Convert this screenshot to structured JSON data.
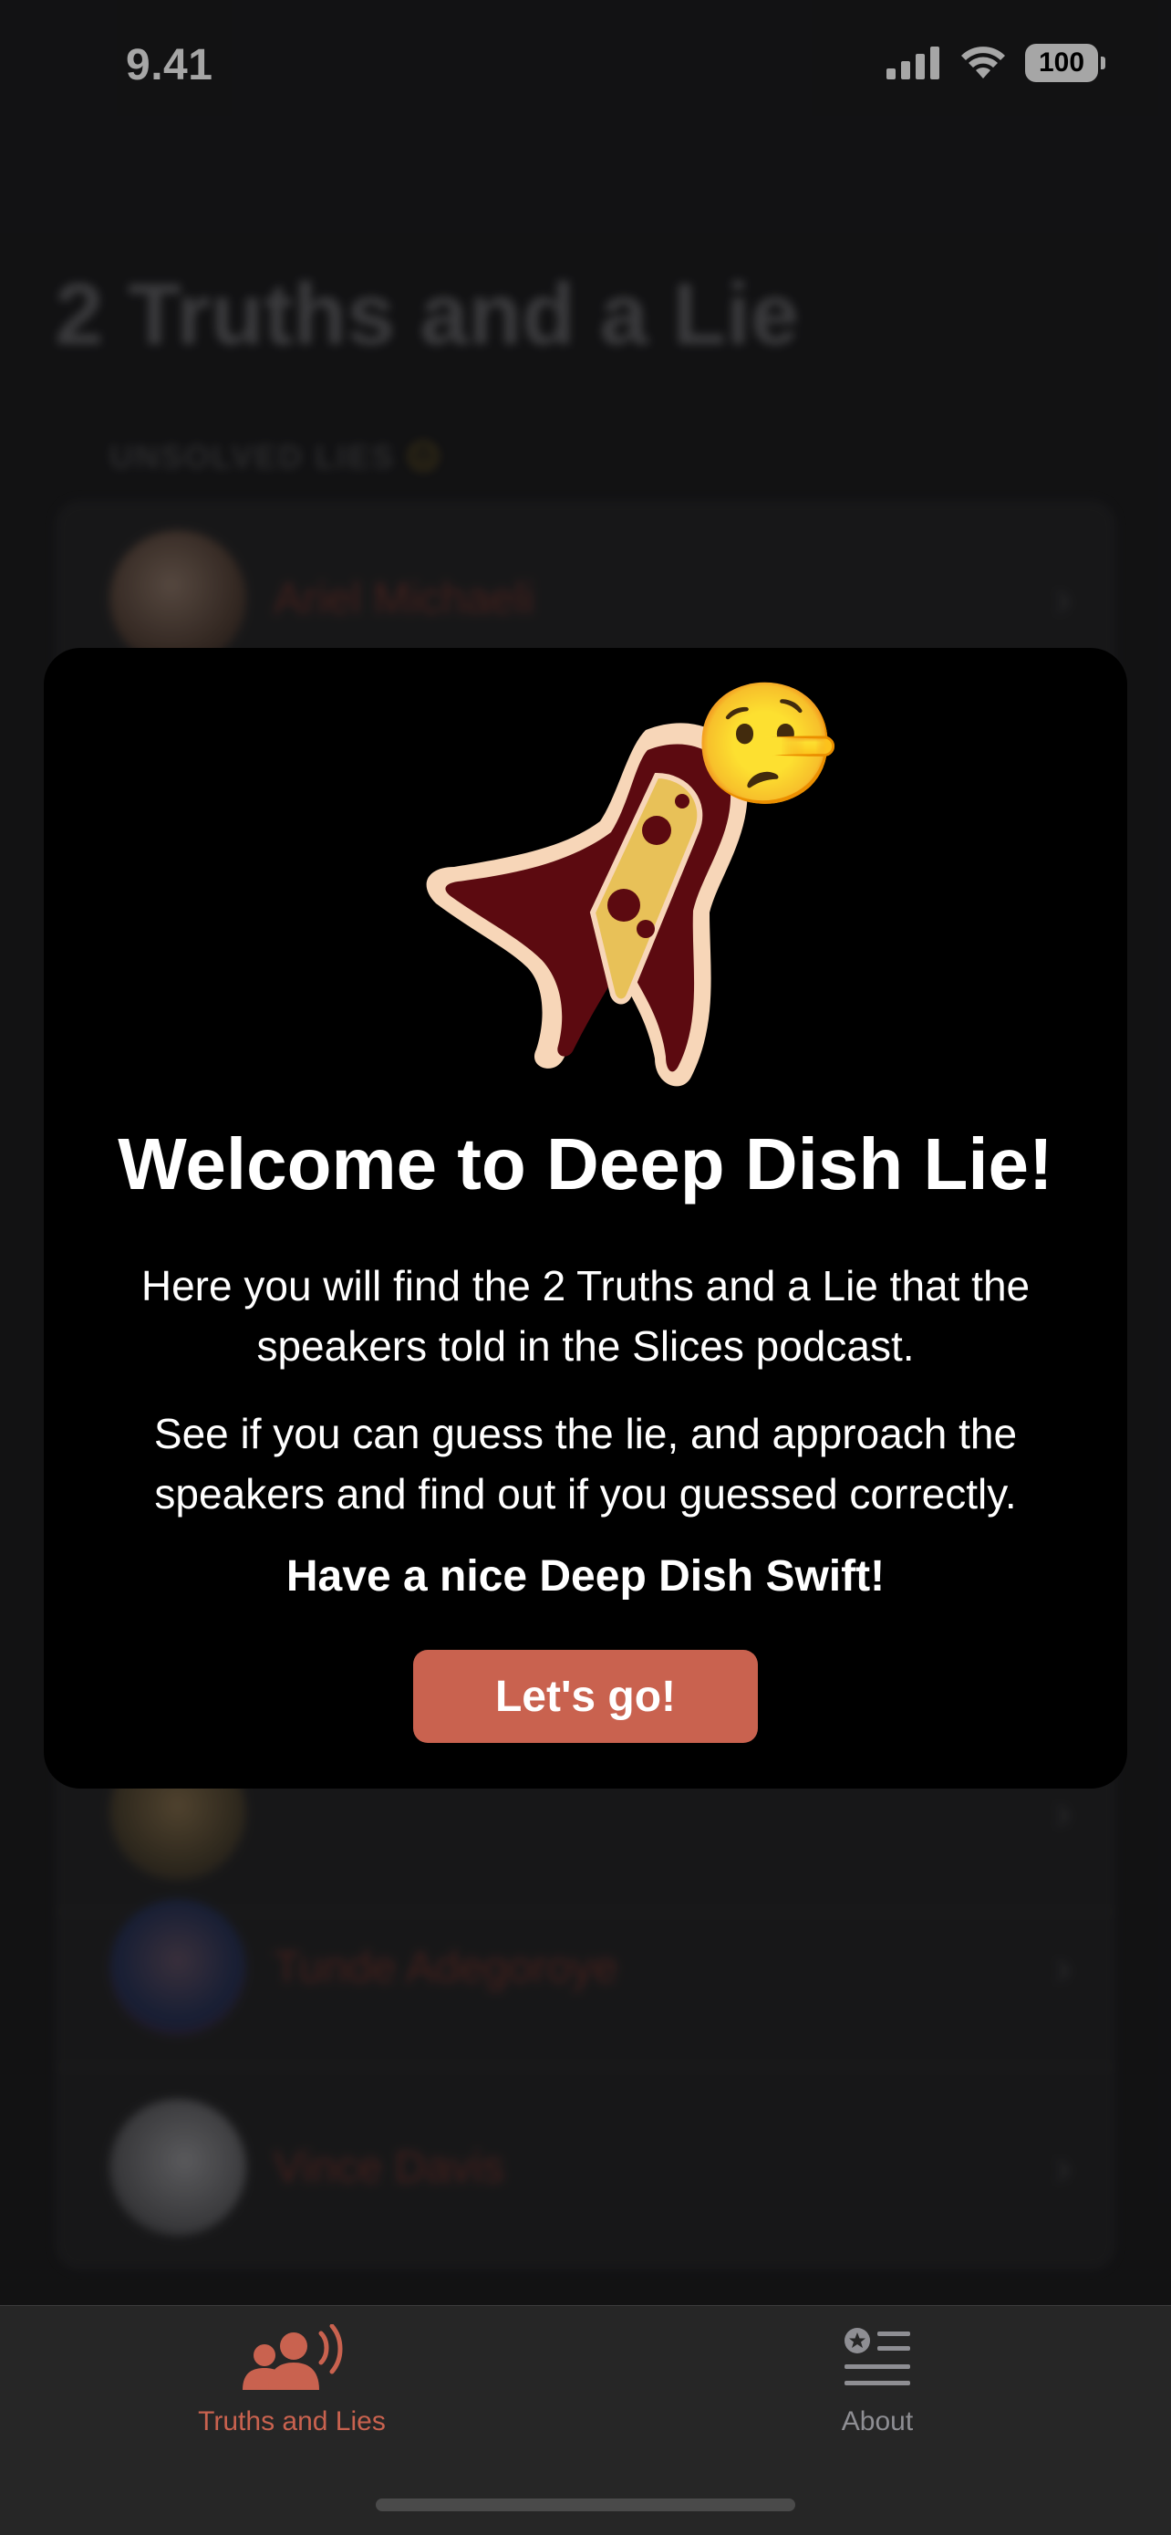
{
  "status_bar": {
    "time": "9.41",
    "battery": "100"
  },
  "background": {
    "title": "2 Truths and a Lie",
    "section_header": "UNSOLVED LIES",
    "section_emoji": "😑",
    "speakers": [
      {
        "name": "Ariel Michaeli"
      },
      {
        "name": "Tunde Adegoroye"
      },
      {
        "name": "Vince Davis"
      }
    ]
  },
  "modal": {
    "title": "Welcome to Deep Dish Lie!",
    "paragraph_1": "Here you will find the 2 Truths and a Lie that the speakers told in the Slices podcast.",
    "paragraph_2": "See if you can guess the lie, and approach the speakers and find out if you guessed correctly.",
    "closing": "Have a nice Deep Dish Swift!",
    "button_label": "Let's go!",
    "logo_emoji": "🤥"
  },
  "tab_bar": {
    "tabs": [
      {
        "label": "Truths and Lies",
        "icon": "people-speaking-icon",
        "selected": true
      },
      {
        "label": "About",
        "icon": "star-list-icon",
        "selected": false
      }
    ]
  },
  "colors": {
    "accent": "#c9624f",
    "modal_bg": "#000000",
    "tab_bar_bg": "#262626"
  }
}
